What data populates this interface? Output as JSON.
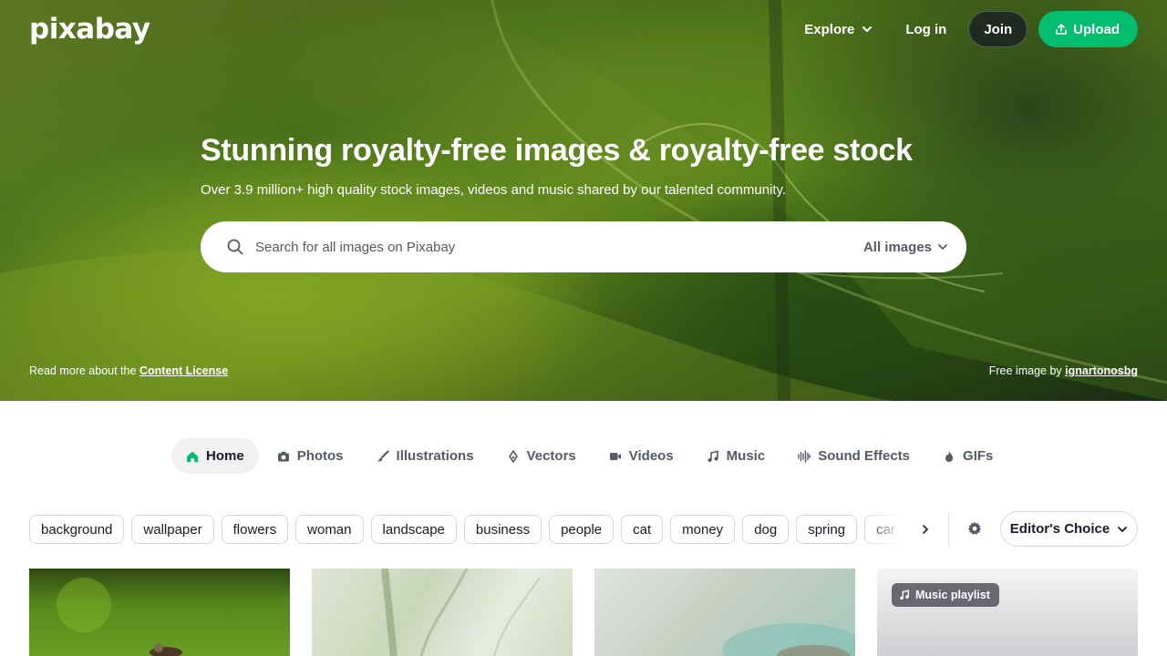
{
  "brand": {
    "logo_text": "pixabay",
    "accent": "#02be6e"
  },
  "topnav": {
    "explore_label": "Explore",
    "login_label": "Log in",
    "join_label": "Join",
    "upload_label": "Upload"
  },
  "hero": {
    "title": "Stunning royalty-free images & royalty-free stock",
    "subtitle": "Over 3.9 million+ high quality stock images, videos and music shared by our talented community.",
    "license_prefix": "Read more about the",
    "license_link": "Content License",
    "credit_prefix": "Free image by",
    "credit_user": "ignartonosbg"
  },
  "search": {
    "placeholder": "Search for all images on Pixabay",
    "type_label": "All images"
  },
  "tabs": [
    {
      "label": "Home",
      "icon": "home-icon",
      "active": true
    },
    {
      "label": "Photos",
      "icon": "camera-icon"
    },
    {
      "label": "Illustrations",
      "icon": "brush-icon"
    },
    {
      "label": "Vectors",
      "icon": "pen-nib-icon"
    },
    {
      "label": "Videos",
      "icon": "video-camera-icon"
    },
    {
      "label": "Music",
      "icon": "music-note-icon"
    },
    {
      "label": "Sound Effects",
      "icon": "waveform-icon"
    },
    {
      "label": "GIFs",
      "icon": "flame-icon"
    }
  ],
  "chips": [
    "background",
    "wallpaper",
    "flowers",
    "woman",
    "landscape",
    "business",
    "people",
    "cat",
    "money",
    "dog",
    "spring",
    "car"
  ],
  "sort": {
    "label": "Editor's Choice"
  },
  "grid": {
    "music_badge": "Music playlist"
  }
}
